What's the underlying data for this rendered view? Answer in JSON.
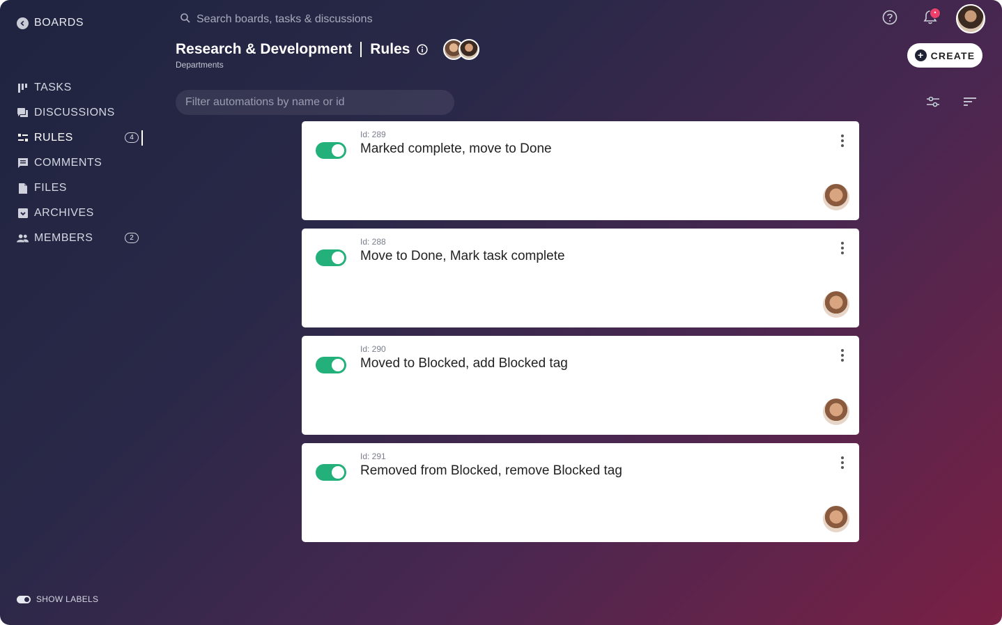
{
  "nav_back": {
    "label": "BOARDS"
  },
  "sidebar": {
    "items": [
      {
        "label": "TASKS",
        "icon": "tasks-icon"
      },
      {
        "label": "DISCUSSIONS",
        "icon": "discussions-icon"
      },
      {
        "label": "RULES",
        "icon": "rules-icon",
        "count": "4",
        "active": true
      },
      {
        "label": "COMMENTS",
        "icon": "comments-icon"
      },
      {
        "label": "FILES",
        "icon": "files-icon"
      },
      {
        "label": "ARCHIVES",
        "icon": "archives-icon"
      },
      {
        "label": "MEMBERS",
        "icon": "members-icon",
        "count": "2"
      }
    ],
    "show_labels": "SHOW LABELS"
  },
  "search": {
    "placeholder": "Search boards, tasks & discussions"
  },
  "header": {
    "title": "Research & Development",
    "section": "Rules",
    "subtitle": "Departments"
  },
  "toolbar": {
    "create_label": "CREATE",
    "filter_placeholder": "Filter automations by name or id"
  },
  "notifications": {
    "badge": "•"
  },
  "rules": [
    {
      "id_label": "Id: 289",
      "name": "Marked complete, move to Done",
      "enabled": true
    },
    {
      "id_label": "Id: 288",
      "name": "Move to Done, Mark task complete",
      "enabled": true
    },
    {
      "id_label": "Id: 290",
      "name": "Moved to Blocked, add Blocked tag",
      "enabled": true
    },
    {
      "id_label": "Id: 291",
      "name": "Removed from Blocked, remove Blocked tag",
      "enabled": true
    }
  ],
  "colors": {
    "toggle_on": "#24b07a",
    "badge": "#ee3f6b",
    "bg_start": "#1f2440",
    "bg_end": "#7a2044"
  }
}
